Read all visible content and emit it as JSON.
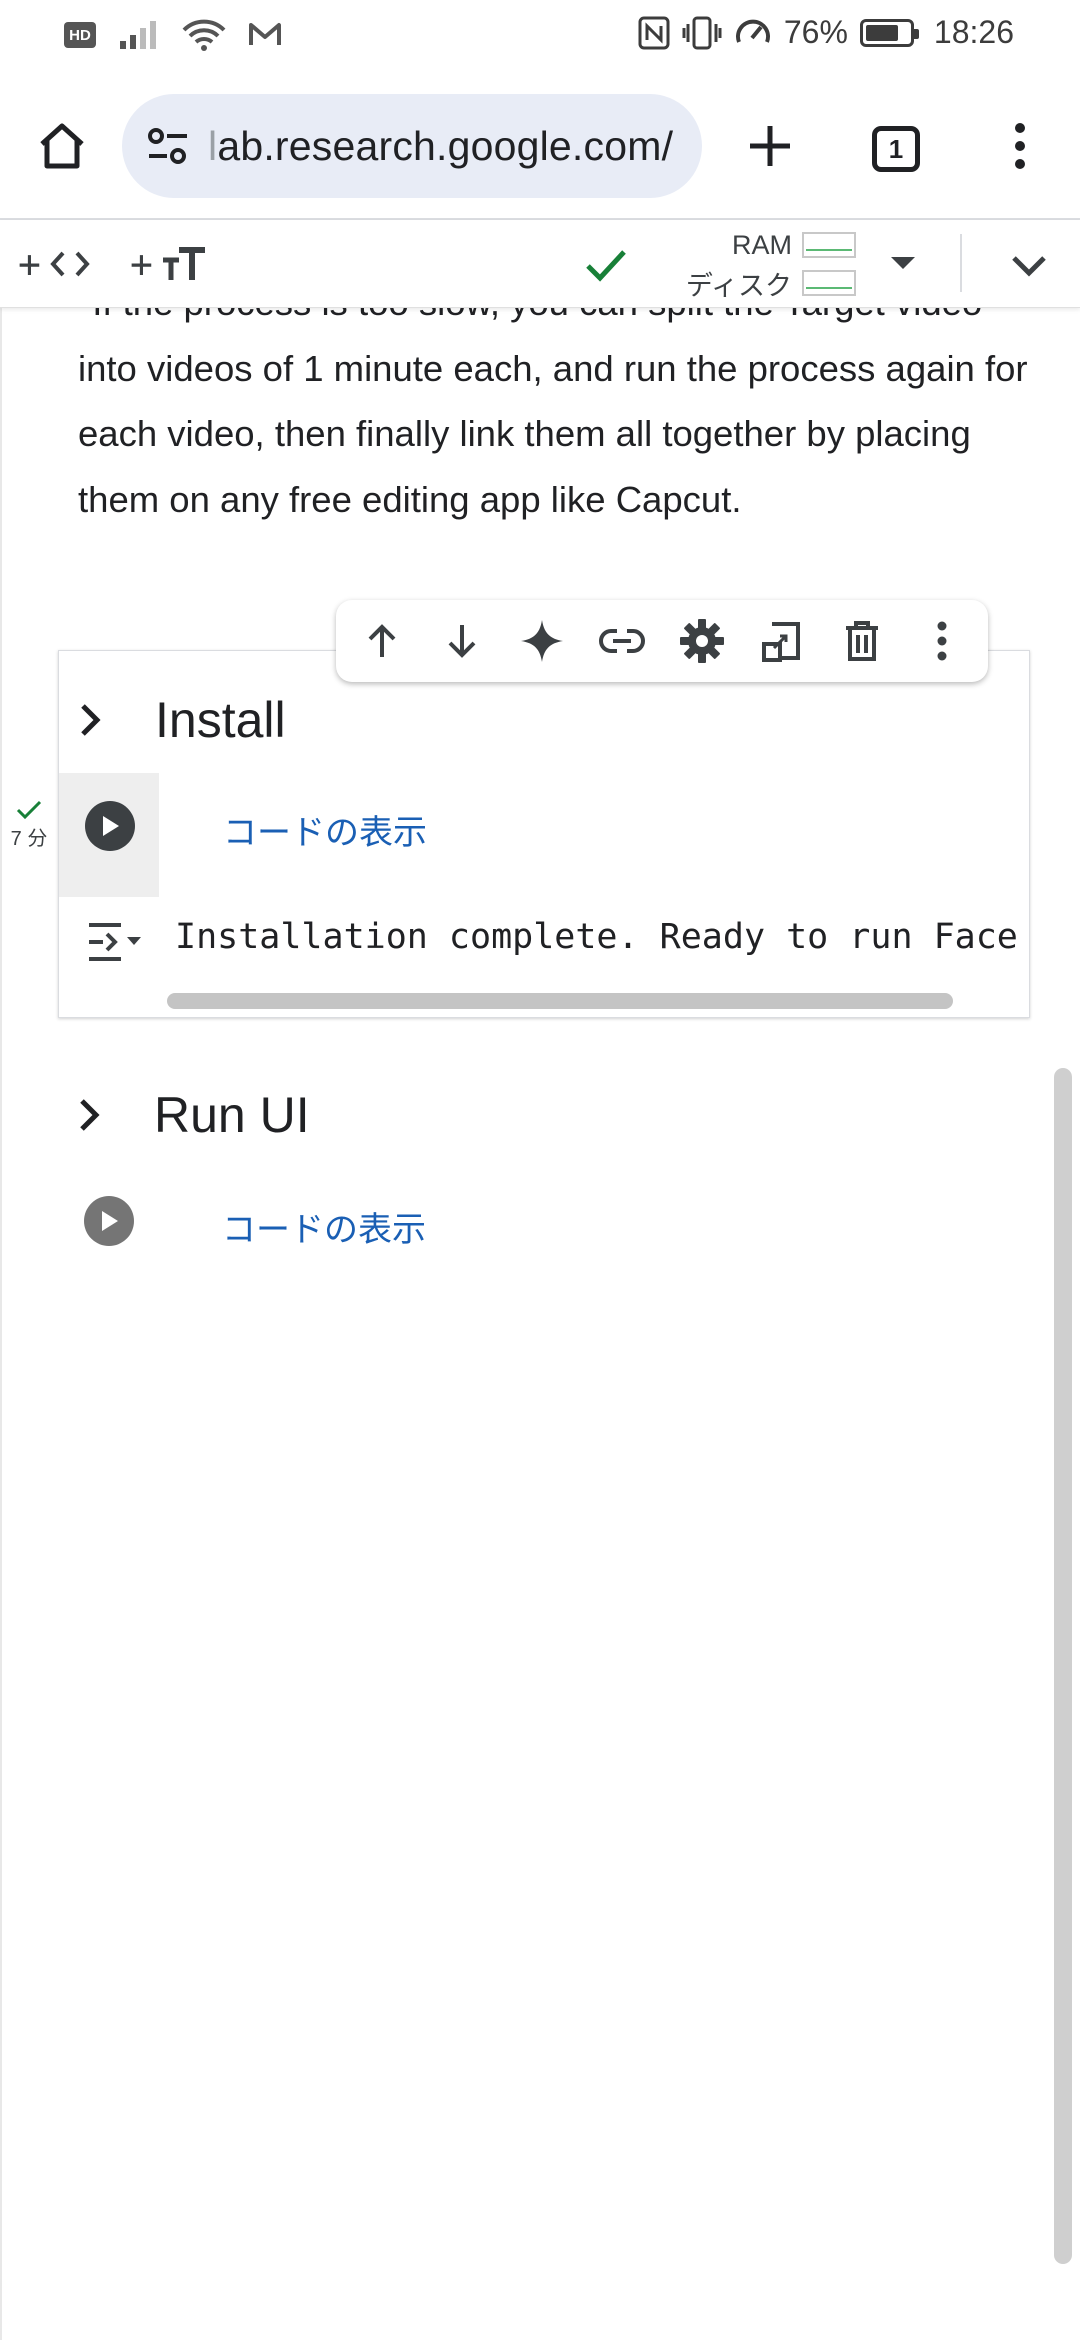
{
  "status_bar": {
    "hd": "HD",
    "battery_percent": "76%",
    "battery_level": 0.76,
    "time": "18:26"
  },
  "browser": {
    "url": "ab.research.google.com/",
    "url_prefix": "l",
    "tab_count": "1"
  },
  "colab_toolbar": {
    "resources": {
      "ram_label": "RAM",
      "disk_label": "ディスク"
    }
  },
  "notebook": {
    "paragraph": "*If the process is too slow, you can split the Target video into videos of 1 minute each, and run the process again for each video, then finally link them all together by placing them on any free editing app like Capcut.",
    "install_section": {
      "title": "Install",
      "show_code": "コードの表示",
      "exec_time": "7 分",
      "output": "Installation complete. Ready to run Face"
    },
    "run_ui_section": {
      "title": "Run UI",
      "show_code": "コードの表示"
    }
  },
  "colors": {
    "accent_link": "#1a5fb4",
    "success_green": "#188038",
    "url_box": "#e8ecf6"
  }
}
